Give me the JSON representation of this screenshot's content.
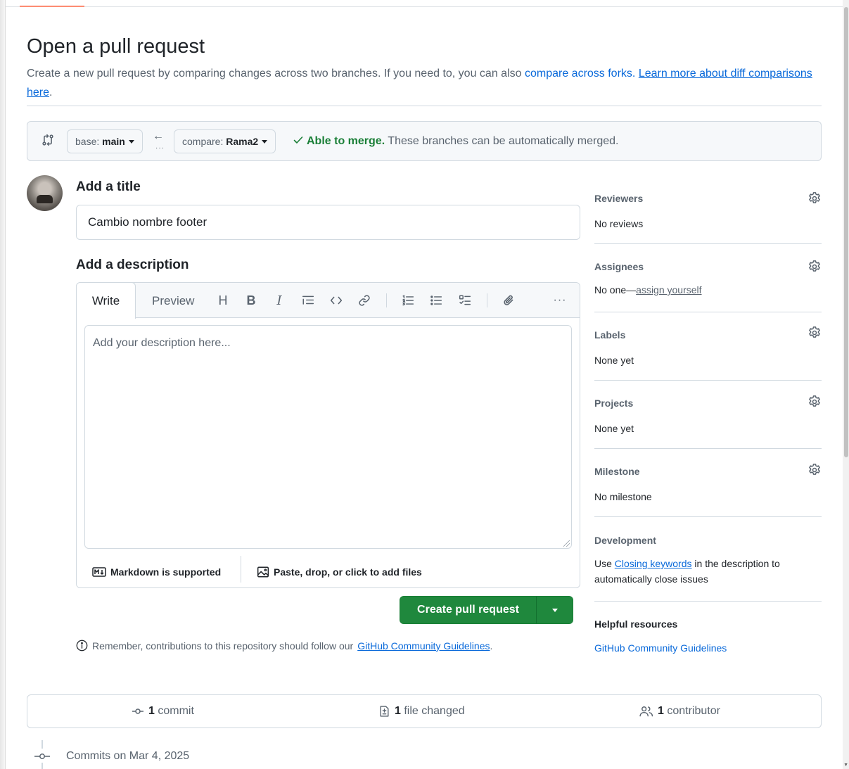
{
  "header": {
    "title": "Open a pull request",
    "intro_text": "Create a new pull request by comparing changes across two branches. If you need to, you can also",
    "compare_forks_link": "compare across forks.",
    "learn_more_link": "Learn more about diff comparisons here",
    "intro_end": "."
  },
  "compare": {
    "base_label": "base:",
    "base_value": "main",
    "compare_label": "compare:",
    "compare_value": "Rama2",
    "merge_status": "Able to merge.",
    "merge_detail": "These branches can be automatically merged."
  },
  "form": {
    "title_heading": "Add a title",
    "title_value": "Cambio nombre footer",
    "description_heading": "Add a description",
    "tab_write": "Write",
    "tab_preview": "Preview",
    "description_placeholder": "Add your description here...",
    "markdown_note": "Markdown is supported",
    "attach_note": "Paste, drop, or click to add files",
    "create_button": "Create pull request",
    "reminder_text": "Remember, contributions to this repository should follow our",
    "reminder_link": "GitHub Community Guidelines",
    "reminder_end": "."
  },
  "toolbar": {
    "heading": "H",
    "bold": "B",
    "italic": "I",
    "more": "···"
  },
  "sidebar": {
    "reviewers_title": "Reviewers",
    "reviewers_value": "No reviews",
    "assignees_title": "Assignees",
    "assignees_value": "No one—",
    "assignees_link": "assign yourself",
    "labels_title": "Labels",
    "labels_value": "None yet",
    "projects_title": "Projects",
    "projects_value": "None yet",
    "milestone_title": "Milestone",
    "milestone_value": "No milestone",
    "development_title": "Development",
    "development_pre": "Use",
    "development_link": "Closing keywords",
    "development_post": "in the description to automatically close issues",
    "helpful_title": "Helpful resources",
    "helpful_link": "GitHub Community Guidelines"
  },
  "stats": {
    "commits_count": "1",
    "commits_label": "commit",
    "files_count": "1",
    "files_label": "file changed",
    "contributors_count": "1",
    "contributors_label": "contributor"
  },
  "timeline": {
    "commits_date": "Commits on Mar 4, 2025"
  },
  "colors": {
    "merge_ok": "#1a7f37",
    "primary_button": "#1f883d",
    "link": "#0969da",
    "muted": "#59636e",
    "border": "#d1d9e0"
  },
  "icons": {
    "compare": "git-compare-icon",
    "check": "check-icon",
    "gear": "gear-icon",
    "markdown": "markdown-icon",
    "image": "image-icon",
    "info": "info-icon",
    "commit": "git-commit-icon",
    "file_diff": "file-diff-icon",
    "people": "people-icon"
  }
}
